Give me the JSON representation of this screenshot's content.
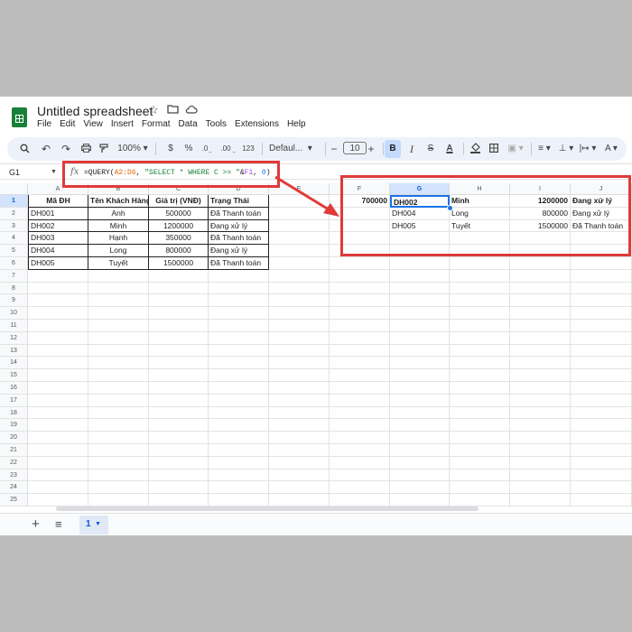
{
  "app": {
    "title": "Untitled spreadsheet",
    "menu": [
      "File",
      "Edit",
      "View",
      "Insert",
      "Format",
      "Data",
      "Tools",
      "Extensions",
      "Help"
    ]
  },
  "toolbar": {
    "zoom": "100%",
    "currency": "$",
    "percent": "%",
    "dec_decrease": ".0",
    "dec_increase": ".00",
    "num_format": "123",
    "font": "Defaul...",
    "font_size": "10",
    "bold": "B",
    "italic": "I",
    "text_color": "A",
    "minus": "−",
    "plus": "+"
  },
  "formula_bar": {
    "name_box": "G1",
    "fx": "fx",
    "formula_parts": [
      "=QUERY(",
      "A2:D6",
      ", ",
      "\"SELECT * WHERE C >= \"",
      "&",
      "F1",
      ", ",
      "0",
      ")"
    ]
  },
  "columns": [
    "A",
    "B",
    "C",
    "D",
    "E",
    "F",
    "G",
    "H",
    "I",
    "J"
  ],
  "rows": [
    "1",
    "2",
    "3",
    "4",
    "5",
    "6",
    "7",
    "8",
    "9",
    "10",
    "11",
    "12",
    "13",
    "14",
    "15",
    "16",
    "17",
    "18",
    "19",
    "20",
    "21",
    "22",
    "23",
    "24",
    "25"
  ],
  "table": {
    "headers": [
      "Mã ĐH",
      "Tên Khách Hàng",
      "Giá trị (VNĐ)",
      "Trạng Thái"
    ],
    "rows": [
      [
        "DH001",
        "Anh",
        "500000",
        "Đã Thanh toán"
      ],
      [
        "DH002",
        "Minh",
        "1200000",
        "Đang xử lý"
      ],
      [
        "DH003",
        "Hạnh",
        "350000",
        "Đã Thanh toán"
      ],
      [
        "DH004",
        "Long",
        "800000",
        "Đang xử lý"
      ],
      [
        "DH005",
        "Tuyết",
        "1500000",
        "Đã Thanh toán"
      ]
    ]
  },
  "criteria": {
    "f1": "700000"
  },
  "query_result": [
    [
      "DH002",
      "Minh",
      "1200000",
      "Đang xử lý"
    ],
    [
      "DH004",
      "Long",
      "800000",
      "Đang xử lý"
    ],
    [
      "DH005",
      "Tuyết",
      "1500000",
      "Đã Thanh toán"
    ]
  ],
  "sheet_tab": {
    "label": "1"
  },
  "colors": {
    "annotation": "#e03a3a",
    "selection": "#1a73e8",
    "sheets_green": "#188038"
  }
}
